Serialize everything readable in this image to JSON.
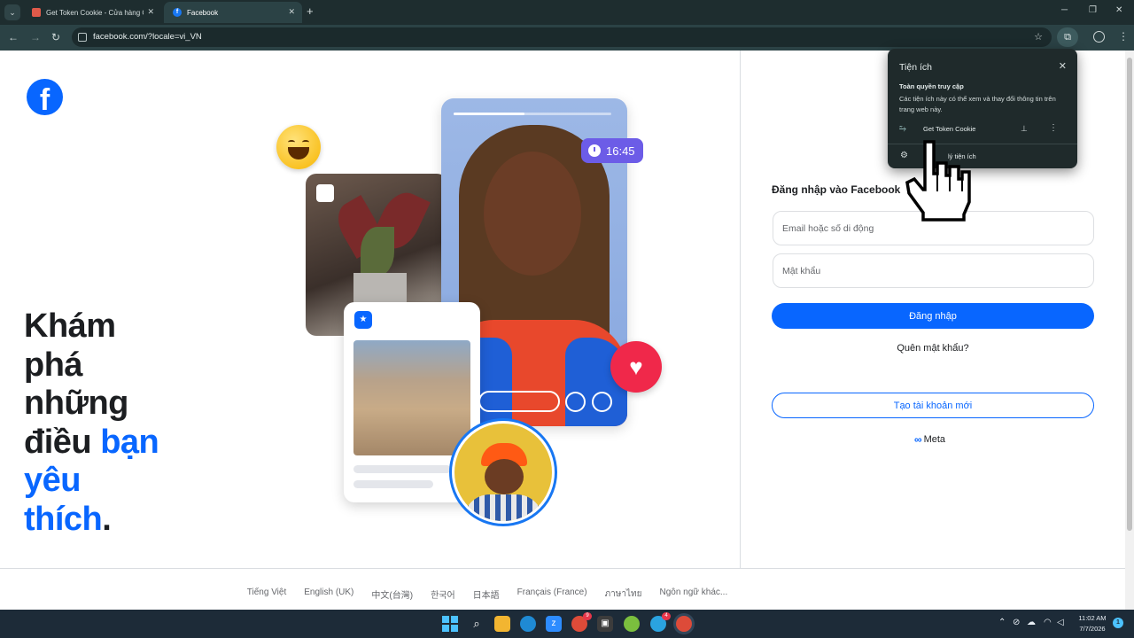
{
  "browser": {
    "tabs": [
      {
        "label": "Get Token Cookie - Cửa hàng C",
        "active": false
      },
      {
        "label": "Facebook",
        "active": true
      }
    ],
    "url": "facebook.com/?locale=vi_VN"
  },
  "page": {
    "hero": {
      "line1": "Khám",
      "line2": "phá",
      "line3": "những",
      "line4_black": "điều",
      "line4_blue": "bạn",
      "line5_blue": "yêu",
      "line6_blue": "thích",
      "period": "."
    },
    "time_pill": "16:45",
    "login": {
      "title": "Đăng nhập vào Facebook",
      "email_placeholder": "Email hoặc số di động",
      "password_placeholder": "Mật khẩu",
      "login_button": "Đăng nhập",
      "forgot_link": "Quên mật khẩu?",
      "create_button": "Tạo tài khoản mới",
      "meta_label": "Meta"
    },
    "languages": [
      "Tiếng Việt",
      "English (UK)",
      "中文(台灣)",
      "한국어",
      "日本語",
      "Français (France)",
      "ภาษาไทย",
      "Ngôn ngữ khác..."
    ]
  },
  "extensions_popup": {
    "title": "Tiện ích",
    "subtitle": "Toàn quyền truy cập",
    "description": "Các tiện ích này có thể xem và thay đổi thông tin trên trang web này.",
    "extension_name": "Get Token Cookie",
    "manage_label": "Quản lý tiện ích",
    "manage_visible": "lý tiện ích"
  },
  "taskbar": {
    "time": "11:02 AM",
    "date": "7/7/2026",
    "notification_count": "1",
    "badges": {
      "chrome": "9",
      "telegram": "4"
    }
  },
  "colors": {
    "accent": "#0866ff",
    "chrome_bg": "#1e2d2f",
    "taskbar_bg": "#1d2b38"
  },
  "icons": [
    "facebook-logo",
    "back-icon",
    "forward-icon",
    "reload-icon",
    "star-icon",
    "puzzle-icon",
    "profile-icon",
    "heart-icon",
    "clock-icon",
    "pin-icon",
    "gear-icon",
    "hand-cursor-icon"
  ]
}
